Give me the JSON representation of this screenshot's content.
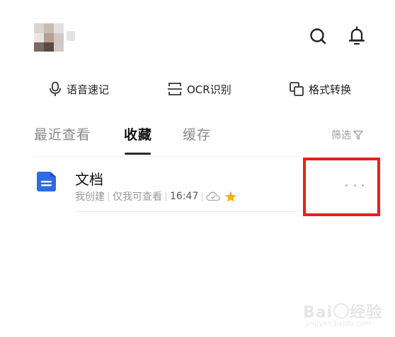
{
  "header": {
    "avatar_icon": "user-avatar-pixelated",
    "search_icon": "search-icon",
    "bell_icon": "bell-icon"
  },
  "tools": [
    {
      "icon": "microphone-icon",
      "label": "语音速记"
    },
    {
      "icon": "ocr-scan-icon",
      "label": "OCR识别"
    },
    {
      "icon": "copy-format-icon",
      "label": "格式转换"
    }
  ],
  "tabs": [
    {
      "label": "最近查看",
      "active": false
    },
    {
      "label": "收藏",
      "active": true
    },
    {
      "label": "缓存",
      "active": false
    }
  ],
  "filter": {
    "label": "筛选",
    "icon": "funnel-icon"
  },
  "files": [
    {
      "icon": "document-icon",
      "title": "文档",
      "creator": "我创建",
      "permission": "仅我可查看",
      "time": "16:47",
      "cloud_icon": "cloud-synced-icon",
      "starred": true
    }
  ],
  "colors": {
    "accent_blue": "#2f6be6",
    "star": "#f5b400",
    "highlight": "#e8201a"
  },
  "watermark": {
    "brand": "Bai",
    "suffix": "经验",
    "url": "jingyan.baidu.com"
  }
}
